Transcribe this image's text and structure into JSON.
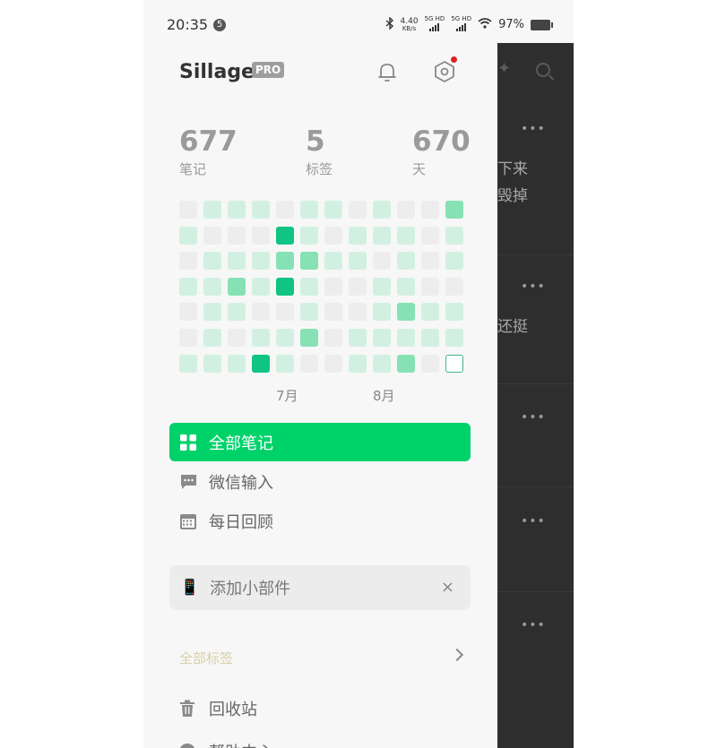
{
  "status_bar": {
    "time": "20:35",
    "badge": "5",
    "net_speed": "4.40",
    "net_unit": "KB/s",
    "sim1": "5G HD",
    "sim2": "5G HD",
    "battery": "97%"
  },
  "drawer": {
    "app_title": "Sillage",
    "pro_badge": "PRO",
    "stats": [
      {
        "value": "677",
        "label": "笔记"
      },
      {
        "value": "5",
        "label": "标签"
      },
      {
        "value": "670",
        "label": "天"
      }
    ],
    "heatmap": {
      "levels": [
        [
          0,
          1,
          1,
          1,
          0,
          1,
          1,
          0,
          1,
          0,
          0,
          2
        ],
        [
          1,
          0,
          0,
          0,
          3,
          1,
          0,
          1,
          1,
          1,
          0,
          1
        ],
        [
          0,
          1,
          1,
          1,
          2,
          2,
          1,
          1,
          0,
          1,
          0,
          1
        ],
        [
          1,
          1,
          2,
          1,
          3,
          1,
          0,
          0,
          1,
          1,
          0,
          0
        ],
        [
          0,
          1,
          1,
          0,
          0,
          1,
          0,
          0,
          1,
          2,
          1,
          1
        ],
        [
          0,
          1,
          0,
          1,
          1,
          2,
          0,
          1,
          1,
          1,
          1,
          1
        ],
        [
          1,
          1,
          1,
          3,
          1,
          0,
          0,
          1,
          1,
          2,
          0,
          -1
        ]
      ],
      "colors": {
        "0": "#ededed",
        "1": "#d2f0e1",
        "2": "#86e2b4",
        "3": "#10c483"
      },
      "months": [
        "7月",
        "8月"
      ]
    },
    "nav": [
      {
        "label": "全部笔记",
        "icon": "grid-icon",
        "active": true
      },
      {
        "label": "微信输入",
        "icon": "message-icon",
        "active": false
      },
      {
        "label": "每日回顾",
        "icon": "calendar-icon",
        "active": false
      }
    ],
    "widget_card": {
      "icon": "📱",
      "label": "添加小部件",
      "close": "×"
    },
    "tags_link": "全部标签",
    "trash": "回收站",
    "help": "帮助中心"
  },
  "background_app": {
    "line1": "下来",
    "line2": "毁掉",
    "line3": "还挺",
    "dots": "•••"
  }
}
